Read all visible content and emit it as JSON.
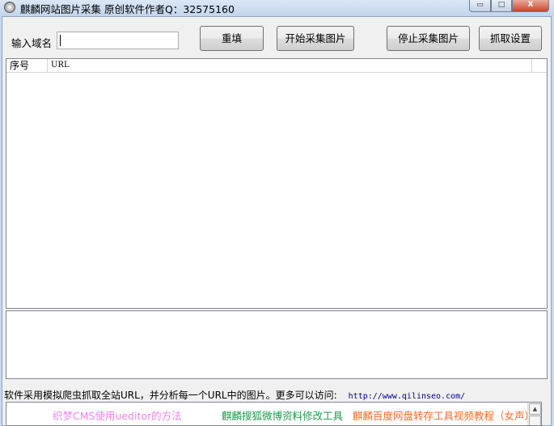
{
  "window": {
    "title": "麒麟网站图片采集 原创软件作者Q：32575160",
    "minimize": "▭",
    "maximize": "□",
    "close": "X"
  },
  "form": {
    "domain_label": "输入域名",
    "domain_value": "",
    "reset": "重填",
    "start": "开始采集图片",
    "stop": "停止采集图片",
    "settings": "抓取设置"
  },
  "table": {
    "columns": [
      "序号",
      "URL"
    ],
    "rows": []
  },
  "status": {
    "text": "软件采用模拟爬虫抓取全站URL，并分析每一个URL中的图片。更多可以访问:",
    "url": "http://www.qilinseo.com/"
  },
  "links": [
    {
      "text": "织梦CMS使用ueditor的方法",
      "color": "#ee82ee"
    },
    {
      "text": "麒麟搜狐微博资料修改工具",
      "color": "#1a9a4a"
    },
    {
      "text": "麒麟百度网盘转存工具视频教程（女声）",
      "color": "#ff6a2a"
    }
  ]
}
